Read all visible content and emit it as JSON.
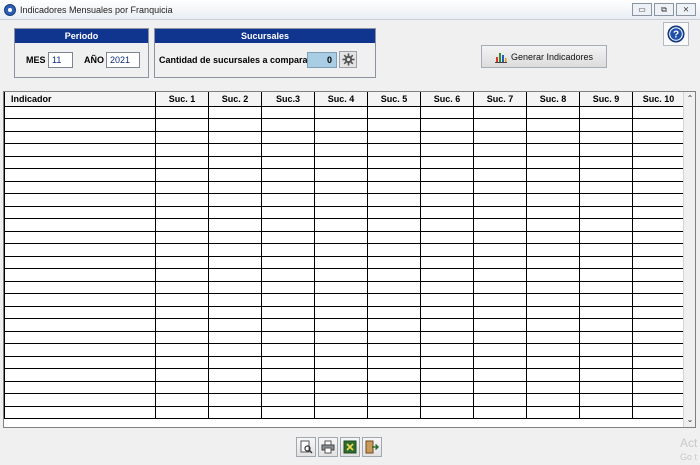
{
  "window": {
    "title": "Indicadores Mensuales por Franquicia",
    "buttons": [
      "▭",
      "⧉",
      "⨯"
    ]
  },
  "periodo": {
    "heading": "Periodo",
    "mes_label": "MES",
    "mes_value": "11",
    "anio_label": "AÑO",
    "anio_value": "2021"
  },
  "sucursales": {
    "heading": "Sucursales",
    "label": "Cantidad de sucursales a comparar",
    "count": "0"
  },
  "generate_button": {
    "label": "Generar Indicadores"
  },
  "help": {
    "icon": "question-icon"
  },
  "table": {
    "columns": [
      "Indicador",
      "Suc. 1",
      "Suc. 2",
      "Suc.3",
      "Suc. 4",
      "Suc. 5",
      "Suc. 6",
      "Suc. 7",
      "Suc. 8",
      "Suc. 9",
      "Suc. 10"
    ],
    "row_count": 25
  },
  "bottom_toolbar": {
    "icons": [
      "preview-icon",
      "print-icon",
      "excel-export-icon",
      "exit-icon"
    ]
  },
  "watermark": {
    "line1": "Act",
    "line2": "Go t"
  },
  "colors": {
    "panel_header": "#10358e",
    "count_box": "#a9cde4"
  }
}
